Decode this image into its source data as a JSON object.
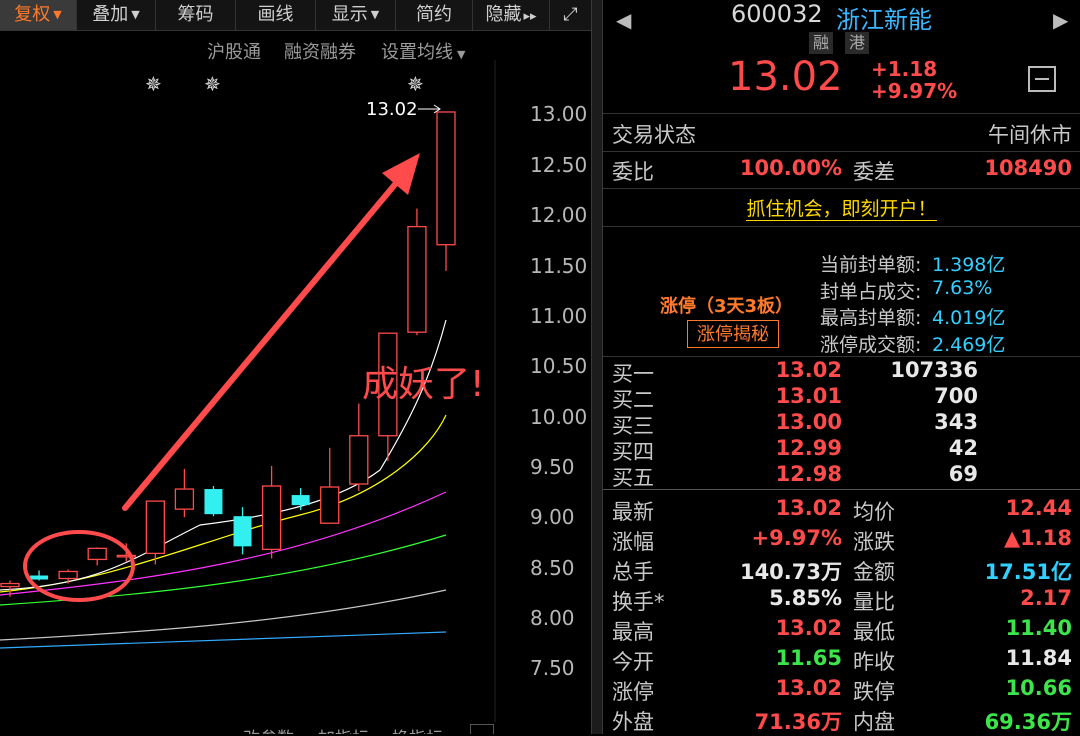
{
  "toolbar": {
    "items": [
      "复权",
      "叠加",
      "筹码",
      "画线",
      "显示",
      "简约",
      "隐藏"
    ],
    "expand_glyph": "⤢"
  },
  "subtoolbar": {
    "hgt": "沪股通",
    "margin": "融资融券",
    "ma_setting": "设置均线"
  },
  "chart": {
    "annotation": "成妖了!",
    "last_price_label": "13.02",
    "y_ticks": [
      "13.00",
      "12.50",
      "12.00",
      "11.50",
      "11.00",
      "10.50",
      "10.00",
      "9.50",
      "9.00",
      "8.50",
      "8.00",
      "7.50"
    ],
    "bottom_tabs": [
      "改参数",
      "加指标",
      "换指标"
    ],
    "colors": {
      "up": "#ff4b4b",
      "down": "#33f0f0",
      "ma5": "#ffffff",
      "ma10": "#ffff00",
      "ma20": "#ff33ff",
      "ma30": "#33ff33",
      "ma60": "#c8c8c8",
      "ma120": "#33aaff",
      "arrow": "#ff4b4b"
    }
  },
  "chart_data": {
    "type": "candlestick",
    "series": [
      {
        "o": 8.3,
        "h": 8.36,
        "l": 8.2,
        "c": 8.33
      },
      {
        "o": 8.41,
        "h": 8.46,
        "l": 8.36,
        "c": 8.37
      },
      {
        "o": 8.38,
        "h": 8.47,
        "l": 8.33,
        "c": 8.45
      },
      {
        "o": 8.57,
        "h": 8.69,
        "l": 8.51,
        "c": 8.68
      },
      {
        "o": 8.61,
        "h": 8.73,
        "l": 8.55,
        "c": 8.61
      },
      {
        "o": 8.63,
        "h": 9.15,
        "l": 8.52,
        "c": 9.15
      },
      {
        "o": 9.07,
        "h": 9.47,
        "l": 8.99,
        "c": 9.27
      },
      {
        "o": 9.27,
        "h": 9.3,
        "l": 9.0,
        "c": 9.02
      },
      {
        "o": 9.0,
        "h": 9.09,
        "l": 8.62,
        "c": 8.7
      },
      {
        "o": 8.67,
        "h": 9.5,
        "l": 8.58,
        "c": 9.3
      },
      {
        "o": 9.21,
        "h": 9.28,
        "l": 9.06,
        "c": 9.11
      },
      {
        "o": 8.93,
        "h": 9.68,
        "l": 8.93,
        "c": 9.29
      },
      {
        "o": 9.32,
        "h": 10.12,
        "l": 9.25,
        "c": 9.8
      },
      {
        "o": 9.8,
        "h": 10.6,
        "l": 9.55,
        "c": 10.82
      },
      {
        "o": 10.83,
        "h": 12.06,
        "l": 10.8,
        "c": 11.88
      },
      {
        "o": 11.7,
        "h": 13.02,
        "l": 11.44,
        "c": 13.02
      }
    ],
    "ylim": [
      7.5,
      13.0
    ]
  },
  "quote": {
    "code": "600032",
    "name": "浙江新能",
    "tags": [
      "融",
      "港"
    ],
    "price": "13.02",
    "change": "+1.18",
    "change_pct": "+9.97%",
    "trade_status_label": "交易状态",
    "trade_status": "午间休市",
    "weibi_label": "委比",
    "weibi": "100.00%",
    "weicha_label": "委差",
    "weicha": "108490",
    "promo": "抓住机会，即刻开户！",
    "limit_title": "涨停（3天3板）",
    "limit_button": "涨停揭秘",
    "limit_rows": [
      {
        "label": "当前封单额:",
        "value": "1.398亿"
      },
      {
        "label": "封单占成交:",
        "value": "7.63%"
      },
      {
        "label": "最高封单额:",
        "value": "4.019亿"
      },
      {
        "label": "涨停成交额:",
        "value": "2.469亿"
      }
    ],
    "bids": [
      {
        "label": "买一",
        "price": "13.02",
        "vol": "107336"
      },
      {
        "label": "买二",
        "price": "13.01",
        "vol": "700"
      },
      {
        "label": "买三",
        "price": "13.00",
        "vol": "343"
      },
      {
        "label": "买四",
        "price": "12.99",
        "vol": "42"
      },
      {
        "label": "买五",
        "price": "12.98",
        "vol": "69"
      }
    ],
    "stats": [
      {
        "l1": "最新",
        "v1": "13.02",
        "c1": "red",
        "l2": "均价",
        "v2": "12.44",
        "c2": "red"
      },
      {
        "l1": "涨幅",
        "v1": "+9.97%",
        "c1": "red",
        "l2": "涨跌",
        "v2": "▲1.18",
        "c2": "red"
      },
      {
        "l1": "总手",
        "v1": "140.73万",
        "c1": "white",
        "l2": "金额",
        "v2": "17.51亿",
        "c2": "cyan"
      },
      {
        "l1": "换手*",
        "v1": "5.85%",
        "c1": "white",
        "l2": "量比",
        "v2": "2.17",
        "c2": "red"
      },
      {
        "l1": "最高",
        "v1": "13.02",
        "c1": "red",
        "l2": "最低",
        "v2": "11.40",
        "c2": "green"
      },
      {
        "l1": "今开",
        "v1": "11.65",
        "c1": "green",
        "l2": "昨收",
        "v2": "11.84",
        "c2": "white"
      },
      {
        "l1": "涨停",
        "v1": "13.02",
        "c1": "red",
        "l2": "跌停",
        "v2": "10.66",
        "c2": "green"
      },
      {
        "l1": "外盘",
        "v1": "71.36万",
        "c1": "red",
        "l2": "内盘",
        "v2": "69.36万",
        "c2": "green"
      }
    ]
  }
}
